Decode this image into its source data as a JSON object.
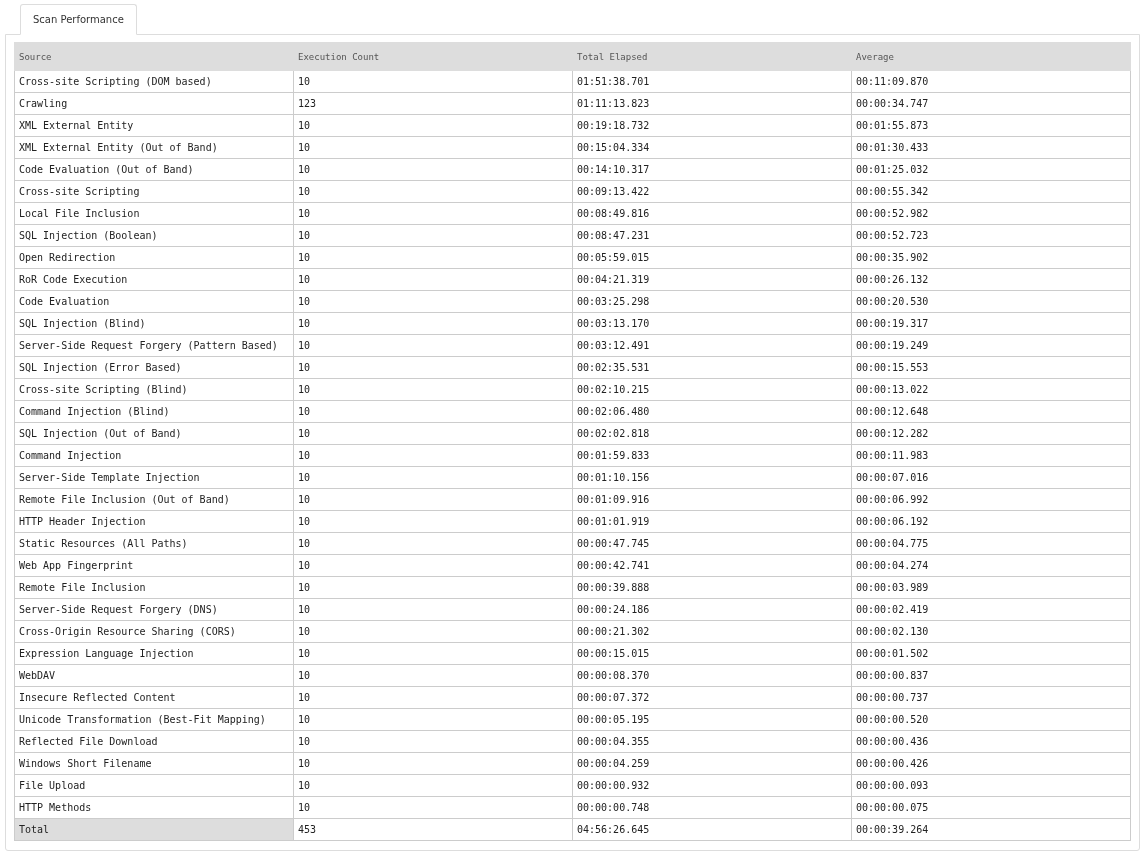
{
  "tabs": [
    {
      "label": "Scan Performance",
      "selected": true
    }
  ],
  "table": {
    "columns": [
      "Source",
      "Execution Count",
      "Total Elapsed",
      "Average"
    ],
    "rows": [
      [
        "Cross-site Scripting (DOM based)",
        "10",
        "01:51:38.701",
        "00:11:09.870"
      ],
      [
        "Crawling",
        "123",
        "01:11:13.823",
        "00:00:34.747"
      ],
      [
        "XML External Entity",
        "10",
        "00:19:18.732",
        "00:01:55.873"
      ],
      [
        "XML External Entity (Out of Band)",
        "10",
        "00:15:04.334",
        "00:01:30.433"
      ],
      [
        "Code Evaluation (Out of Band)",
        "10",
        "00:14:10.317",
        "00:01:25.032"
      ],
      [
        "Cross-site Scripting",
        "10",
        "00:09:13.422",
        "00:00:55.342"
      ],
      [
        "Local File Inclusion",
        "10",
        "00:08:49.816",
        "00:00:52.982"
      ],
      [
        "SQL Injection (Boolean)",
        "10",
        "00:08:47.231",
        "00:00:52.723"
      ],
      [
        "Open Redirection",
        "10",
        "00:05:59.015",
        "00:00:35.902"
      ],
      [
        "RoR Code Execution",
        "10",
        "00:04:21.319",
        "00:00:26.132"
      ],
      [
        "Code Evaluation",
        "10",
        "00:03:25.298",
        "00:00:20.530"
      ],
      [
        "SQL Injection (Blind)",
        "10",
        "00:03:13.170",
        "00:00:19.317"
      ],
      [
        "Server-Side Request Forgery (Pattern Based)",
        "10",
        "00:03:12.491",
        "00:00:19.249"
      ],
      [
        "SQL Injection (Error Based)",
        "10",
        "00:02:35.531",
        "00:00:15.553"
      ],
      [
        "Cross-site Scripting (Blind)",
        "10",
        "00:02:10.215",
        "00:00:13.022"
      ],
      [
        "Command Injection (Blind)",
        "10",
        "00:02:06.480",
        "00:00:12.648"
      ],
      [
        "SQL Injection (Out of Band)",
        "10",
        "00:02:02.818",
        "00:00:12.282"
      ],
      [
        "Command Injection",
        "10",
        "00:01:59.833",
        "00:00:11.983"
      ],
      [
        "Server-Side Template Injection",
        "10",
        "00:01:10.156",
        "00:00:07.016"
      ],
      [
        "Remote File Inclusion (Out of Band)",
        "10",
        "00:01:09.916",
        "00:00:06.992"
      ],
      [
        "HTTP Header Injection",
        "10",
        "00:01:01.919",
        "00:00:06.192"
      ],
      [
        "Static Resources (All Paths)",
        "10",
        "00:00:47.745",
        "00:00:04.775"
      ],
      [
        "Web App Fingerprint",
        "10",
        "00:00:42.741",
        "00:00:04.274"
      ],
      [
        "Remote File Inclusion",
        "10",
        "00:00:39.888",
        "00:00:03.989"
      ],
      [
        "Server-Side Request Forgery (DNS)",
        "10",
        "00:00:24.186",
        "00:00:02.419"
      ],
      [
        "Cross-Origin Resource Sharing (CORS)",
        "10",
        "00:00:21.302",
        "00:00:02.130"
      ],
      [
        "Expression Language Injection",
        "10",
        "00:00:15.015",
        "00:00:01.502"
      ],
      [
        "WebDAV",
        "10",
        "00:00:08.370",
        "00:00:00.837"
      ],
      [
        "Insecure Reflected Content",
        "10",
        "00:00:07.372",
        "00:00:00.737"
      ],
      [
        "Unicode Transformation (Best-Fit Mapping)",
        "10",
        "00:00:05.195",
        "00:00:00.520"
      ],
      [
        "Reflected File Download",
        "10",
        "00:00:04.355",
        "00:00:00.436"
      ],
      [
        "Windows Short Filename",
        "10",
        "00:00:04.259",
        "00:00:00.426"
      ],
      [
        "File Upload",
        "10",
        "00:00:00.932",
        "00:00:00.093"
      ],
      [
        "HTTP Methods",
        "10",
        "00:00:00.748",
        "00:00:00.075"
      ]
    ],
    "total": [
      "Total",
      "453",
      "04:56:26.645",
      "00:00:39.264"
    ]
  }
}
